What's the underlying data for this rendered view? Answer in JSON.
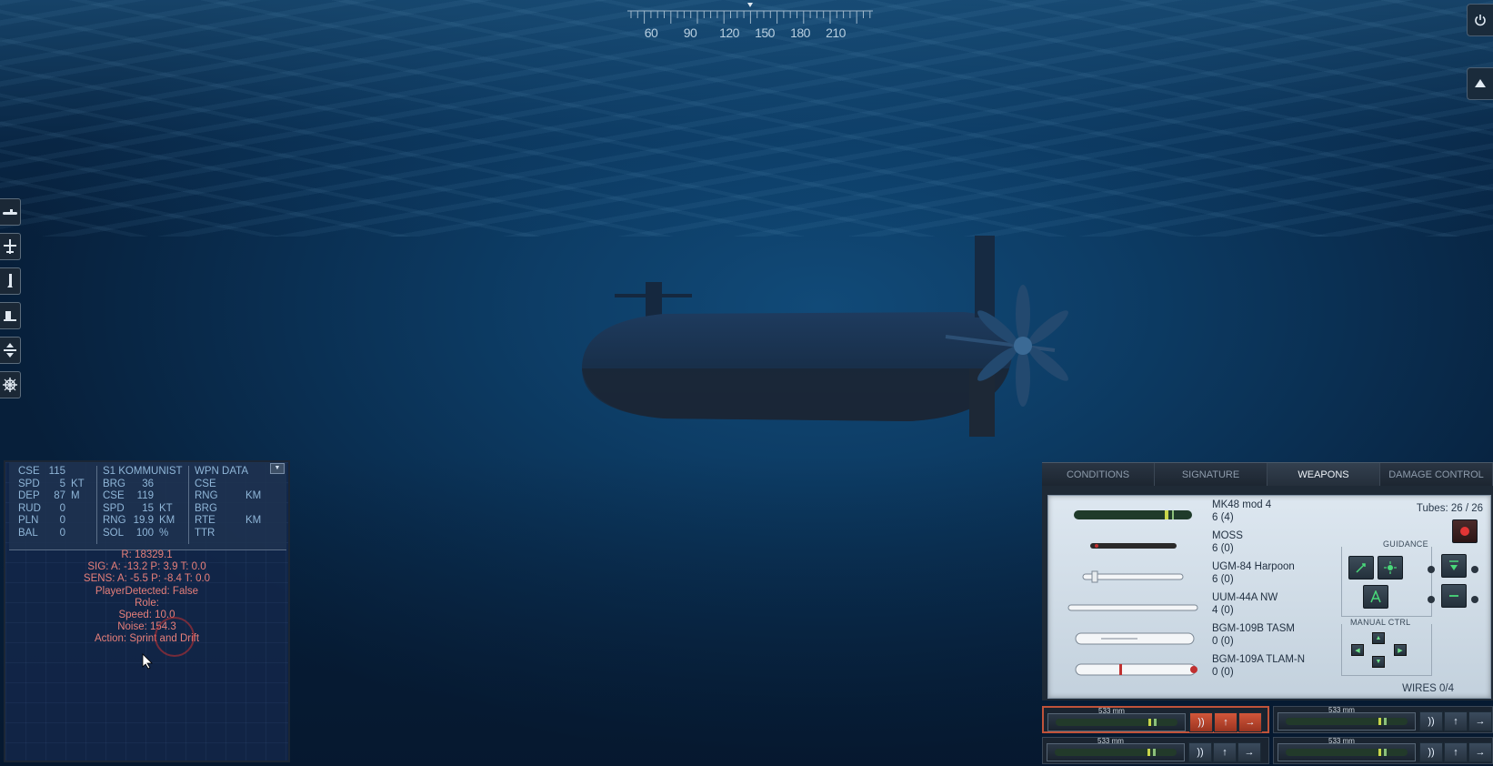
{
  "compass": {
    "labels": [
      "60",
      "90",
      "120",
      "150",
      "180",
      "210"
    ]
  },
  "left_toolbar": [
    "submarine-icon",
    "aircraft-icon",
    "missile-icon",
    "ship-icon",
    "depth-icon",
    "helm-icon"
  ],
  "ownship": {
    "rows": [
      {
        "label": "CSE",
        "value": "115",
        "unit": ""
      },
      {
        "label": "SPD",
        "value": "5",
        "unit": "KT"
      },
      {
        "label": "DEP",
        "value": "87",
        "unit": "M"
      },
      {
        "label": "RUD",
        "value": "0",
        "unit": ""
      },
      {
        "label": "PLN",
        "value": "0",
        "unit": ""
      },
      {
        "label": "BAL",
        "value": "0",
        "unit": ""
      }
    ]
  },
  "contact": {
    "title": "S1 KOMMUNIST",
    "rows": [
      {
        "label": "BRG",
        "value": "36",
        "unit": ""
      },
      {
        "label": "CSE",
        "value": "119",
        "unit": ""
      },
      {
        "label": "SPD",
        "value": "15",
        "unit": "KT"
      },
      {
        "label": "RNG",
        "value": "19.9",
        "unit": "KM"
      },
      {
        "label": "SOL",
        "value": "100",
        "unit": "%"
      }
    ]
  },
  "wpn_data": {
    "title": "WPN DATA",
    "rows": [
      {
        "label": "CSE",
        "unit": ""
      },
      {
        "label": "RNG",
        "unit": "KM"
      },
      {
        "label": "BRG",
        "unit": ""
      },
      {
        "label": "RTE",
        "unit": "KM"
      },
      {
        "label": "TTR",
        "unit": ""
      }
    ]
  },
  "debug_lines": [
    "R: 18329.1",
    "SIG: A: -13.2 P: 3.9 T: 0.0",
    "SENS: A: -5.5 P: -8.4 T: 0.0",
    "PlayerDetected: False",
    "Role:",
    "Speed: 10.0",
    "Noise: 154.3",
    "Action: Sprint and Drift"
  ],
  "tabs": [
    "CONDITIONS",
    "SIGNATURE",
    "WEAPONS",
    "DAMAGE CONTROL"
  ],
  "active_tab": "WEAPONS",
  "weapons": [
    {
      "name": "MK48 mod 4",
      "count": "6 (4)"
    },
    {
      "name": "MOSS",
      "count": "6 (0)"
    },
    {
      "name": "UGM-84 Harpoon",
      "count": "6 (0)"
    },
    {
      "name": "UUM-44A NW",
      "count": "4 (0)"
    },
    {
      "name": "BGM-109B TASM",
      "count": "0 (0)"
    },
    {
      "name": "BGM-109A TLAM-N",
      "count": "0 (0)"
    }
  ],
  "tubes_label": "Tubes: 26 / 26",
  "guidance_label": "GUIDANCE",
  "manual_ctrl_label": "MANUAL CTRL",
  "wires_label": "WIRES 0/4",
  "tube_caliber": "533 mm",
  "colors": {
    "accent_red": "#c0533a",
    "panel_light": "#dde7f0",
    "hud_blue": "#8fb6d8",
    "debug_red": "#e67f7a"
  }
}
